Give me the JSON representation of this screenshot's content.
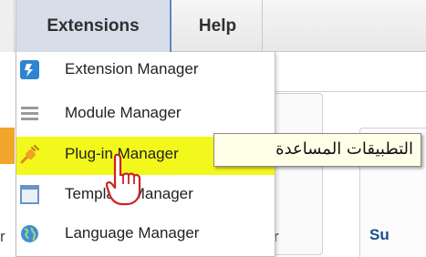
{
  "menubar": {
    "items": [
      {
        "label": "Extensions"
      },
      {
        "label": "Help"
      }
    ]
  },
  "dropdown": {
    "items": [
      {
        "label": "Extension Manager",
        "icon": "extension-icon"
      },
      {
        "label": "Module Manager",
        "icon": "module-icon"
      },
      {
        "label": "Plug-in Manager",
        "icon": "plugin-icon",
        "highlighted": true
      },
      {
        "label": "Template Manager",
        "icon": "template-icon"
      },
      {
        "label": "Language Manager",
        "icon": "language-icon"
      }
    ]
  },
  "tooltip": {
    "text": "التطبيقات المساعدة"
  },
  "background": {
    "left_fragment": "r",
    "mid_fragment": "r",
    "right_fragment": "Su"
  },
  "colors": {
    "highlight": "#f3f81c",
    "tooltip_bg": "#ffffe8",
    "active_tab_border": "#5e86c4"
  }
}
